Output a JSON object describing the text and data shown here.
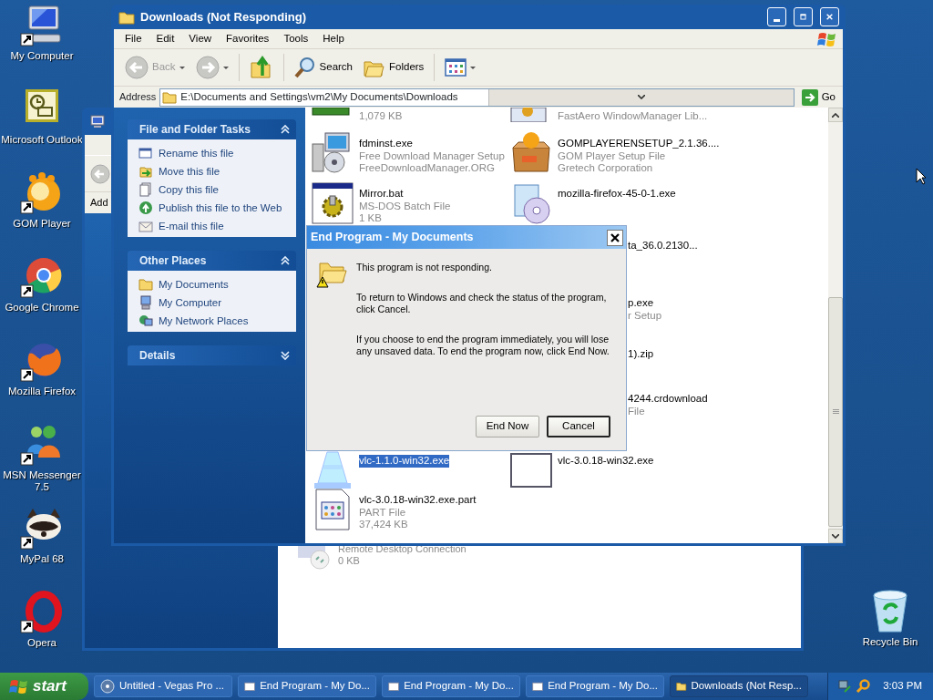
{
  "desktop_icons": [
    {
      "label": "My Computer"
    },
    {
      "label": "Microsoft Outlook"
    },
    {
      "label": "GOM Player"
    },
    {
      "label": "Google Chrome"
    },
    {
      "label": "Mozilla Firefox"
    },
    {
      "label": "MSN Messenger 7.5"
    },
    {
      "label": "MyPal 68"
    },
    {
      "label": "Opera"
    }
  ],
  "recycle_bin": {
    "label": "Recycle Bin"
  },
  "background_window": {
    "address_label": "Add",
    "file": {
      "name": "Remote Desktop Connection",
      "size": "0 KB"
    }
  },
  "window": {
    "title": "Downloads (Not Responding)",
    "menu": [
      "File",
      "Edit",
      "View",
      "Favorites",
      "Tools",
      "Help"
    ],
    "toolbar": [
      {
        "kind": "back",
        "label": "Back",
        "disabled": true
      },
      {
        "kind": "forward",
        "disabled": true
      },
      {
        "kind": "up",
        "disabled": false
      },
      {
        "kind": "search",
        "label": "Search",
        "disabled": false
      },
      {
        "kind": "folders",
        "label": "Folders",
        "disabled": false
      },
      {
        "kind": "views"
      }
    ],
    "address": {
      "label": "Address",
      "value": "E:\\Documents and Settings\\vm2\\My Documents\\Downloads",
      "go": "Go"
    },
    "task_panes": [
      {
        "title": "File and Folder Tasks",
        "expanded": true,
        "items": [
          "Rename this file",
          "Move this file",
          "Copy this file",
          "Publish this file to the Web",
          "E-mail this file"
        ]
      },
      {
        "title": "Other Places",
        "expanded": true,
        "items": [
          "My Documents",
          "My Computer",
          "My Network Places"
        ]
      },
      {
        "title": "Details",
        "expanded": false
      }
    ],
    "file_rows": [
      {
        "cells": [
          {
            "kind": "top_cut",
            "lines": [
              "1,079 KB"
            ]
          },
          {
            "kind": "top_cut",
            "lines": [
              "FastAero WindowManager Lib..."
            ]
          }
        ]
      },
      {
        "cells": [
          {
            "kind": "file",
            "lines": [
              "fdminst.exe",
              "Free Download Manager Setup",
              "FreeDownloadManager.ORG"
            ],
            "selected": false
          },
          {
            "kind": "file",
            "lines": [
              "GOMPLAYERENSETUP_2.1.36....",
              "GOM Player Setup File",
              "Gretech Corporation"
            ],
            "selected": false
          }
        ]
      },
      {
        "cells": [
          {
            "kind": "file",
            "lines": [
              "Mirror.bat",
              "MS-DOS Batch File",
              "1 KB"
            ],
            "selected": false
          },
          {
            "kind": "file",
            "lines": [
              "mozilla-firefox-45-0-1.exe"
            ],
            "selected": false
          }
        ]
      },
      {
        "cells": [
          {
            "kind": "covered",
            "lines": [
              "ta_36.0.2130..."
            ]
          }
        ]
      },
      {
        "cells": [
          {
            "kind": "covered",
            "lines": [
              "p.exe",
              "r Setup"
            ]
          }
        ]
      },
      {
        "cells": [
          {
            "kind": "covered",
            "lines": [
              "1).zip"
            ]
          }
        ]
      },
      {
        "cells": [
          {
            "kind": "covered",
            "lines": [
              "4244.crdownload",
              "File"
            ]
          }
        ]
      },
      {
        "cells": [
          {
            "kind": "file",
            "lines": [
              "vlc-1.1.0-win32.exe"
            ],
            "selected": true
          },
          {
            "kind": "file",
            "lines": [
              "vlc-3.0.18-win32.exe"
            ],
            "selected": false
          }
        ]
      },
      {
        "cells": [
          {
            "kind": "file",
            "lines": [
              "vlc-3.0.18-win32.exe.part",
              "PART File",
              "37,424 KB"
            ],
            "selected": false
          }
        ]
      }
    ]
  },
  "dialog": {
    "title": "End Program - My Documents",
    "paragraphs": [
      "This program is not responding.",
      "To return to Windows and check the status of the program, click Cancel.",
      "If you choose to end the program immediately, you will lose any unsaved data. To end the program now, click End Now."
    ],
    "buttons": [
      {
        "label": "End Now",
        "default": false
      },
      {
        "label": "Cancel",
        "default": true
      }
    ]
  },
  "taskbar": {
    "start": "start",
    "tasks": [
      {
        "label": "Untitled - Vegas Pro ...",
        "selected": false
      },
      {
        "label": "End Program - My Do...",
        "selected": false
      },
      {
        "label": "End Program - My Do...",
        "selected": false
      },
      {
        "label": "End Program - My Do...",
        "selected": false
      },
      {
        "label": "Downloads (Not Resp...",
        "selected": true
      }
    ],
    "clock": "3:03 PM"
  }
}
